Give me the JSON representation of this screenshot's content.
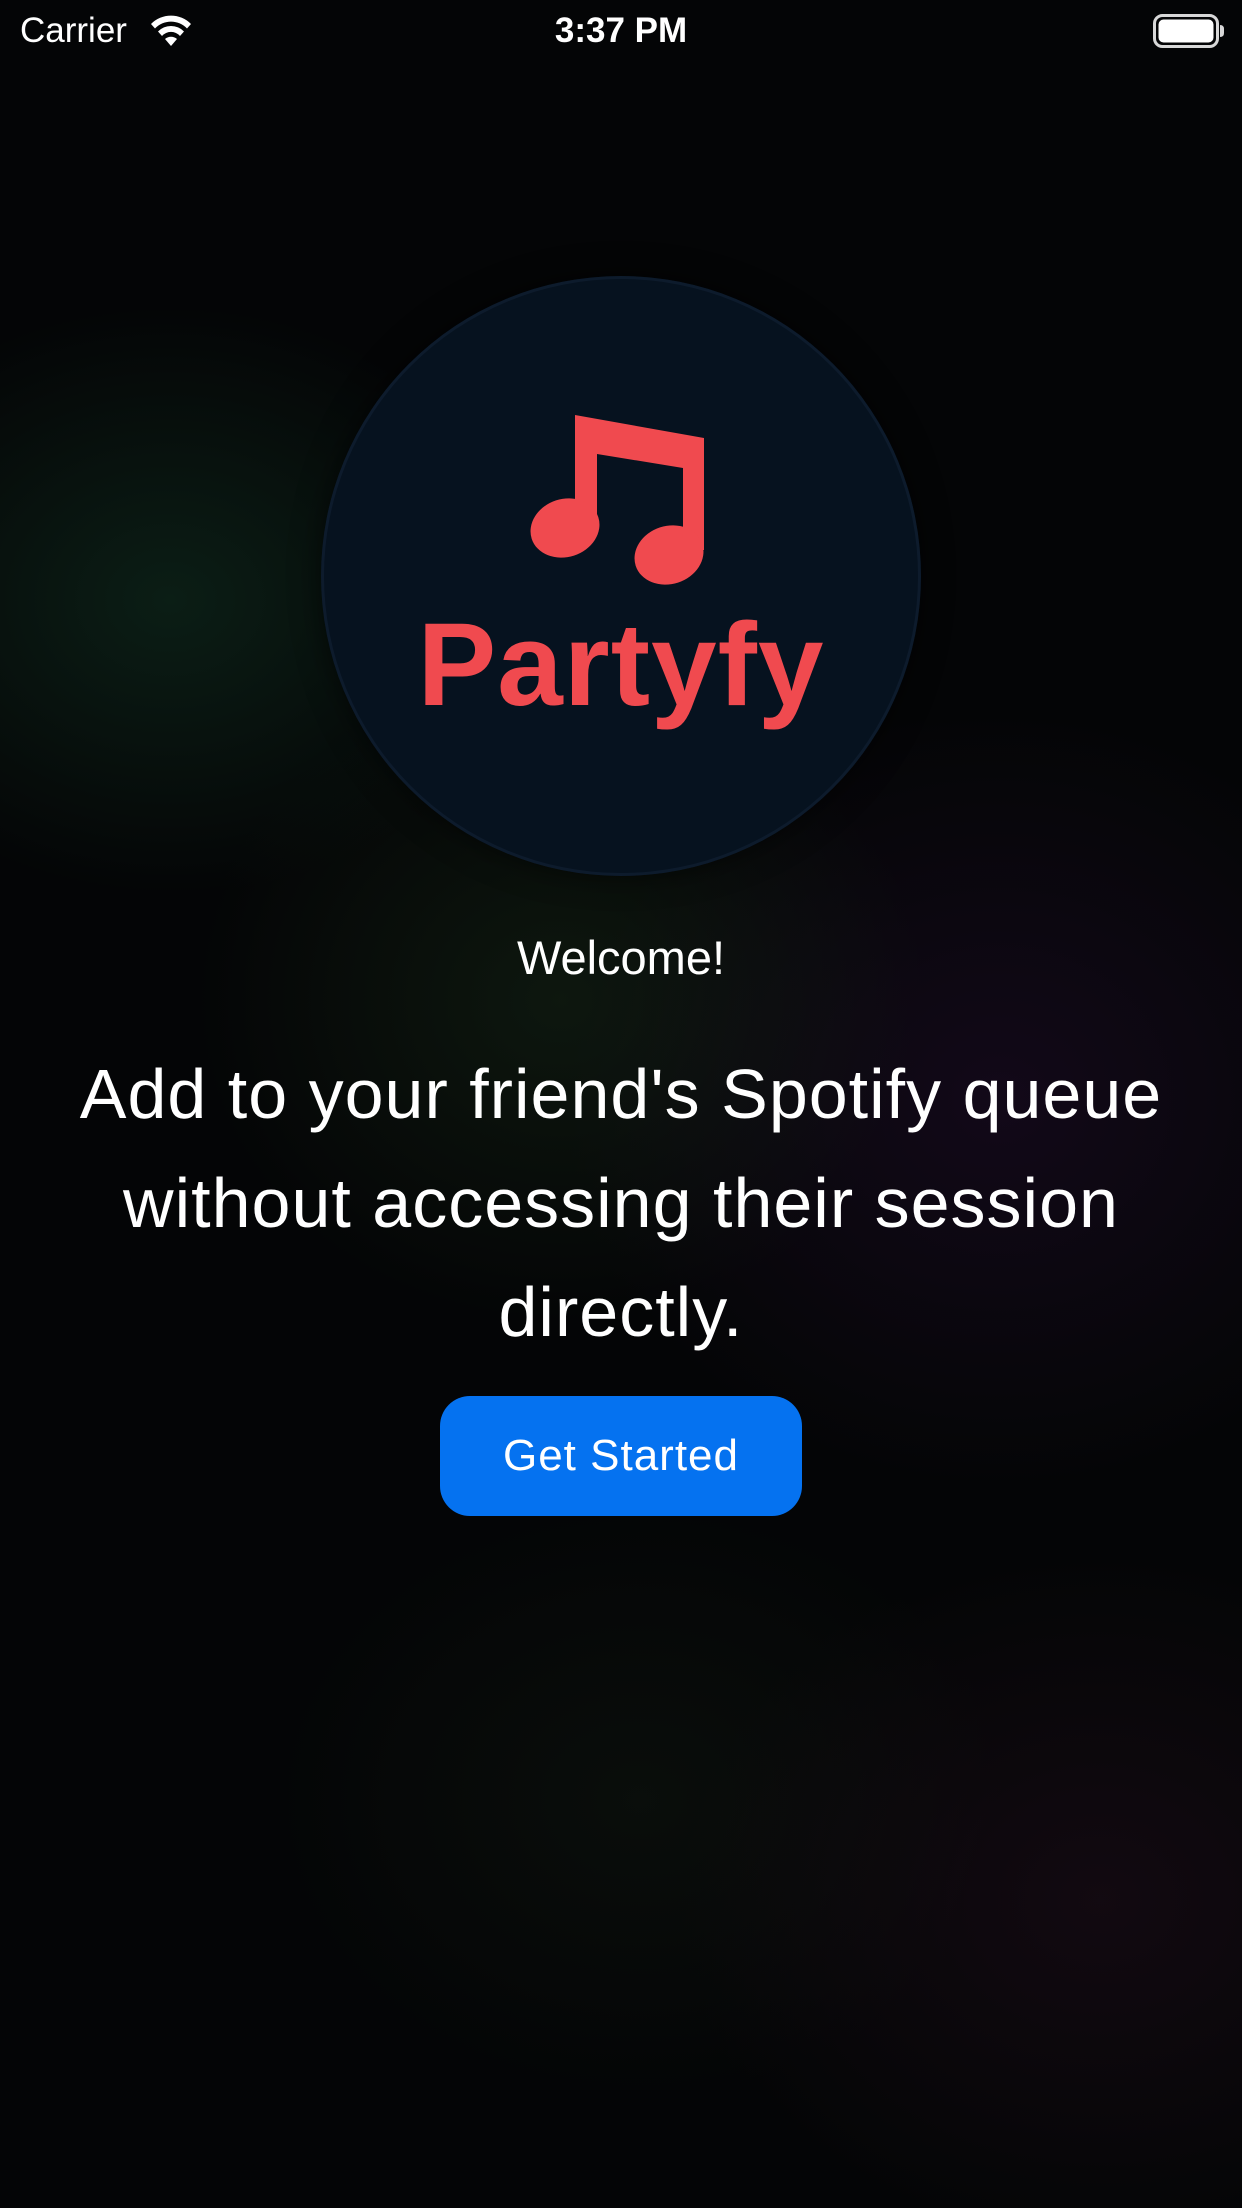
{
  "status_bar": {
    "carrier": "Carrier",
    "time": "3:37 PM",
    "icons": [
      "wifi-icon",
      "battery-icon"
    ]
  },
  "logo": {
    "icon": "music-note-icon",
    "wordmark": "Partyfy",
    "color": "#f04a4f",
    "circle_color": "#06121f"
  },
  "content": {
    "welcome": "Welcome!",
    "tagline": "Add to your friend's Spotify queue without accessing their session directly."
  },
  "actions": {
    "get_started_label": "Get Started",
    "button_color": "#0572f0"
  }
}
